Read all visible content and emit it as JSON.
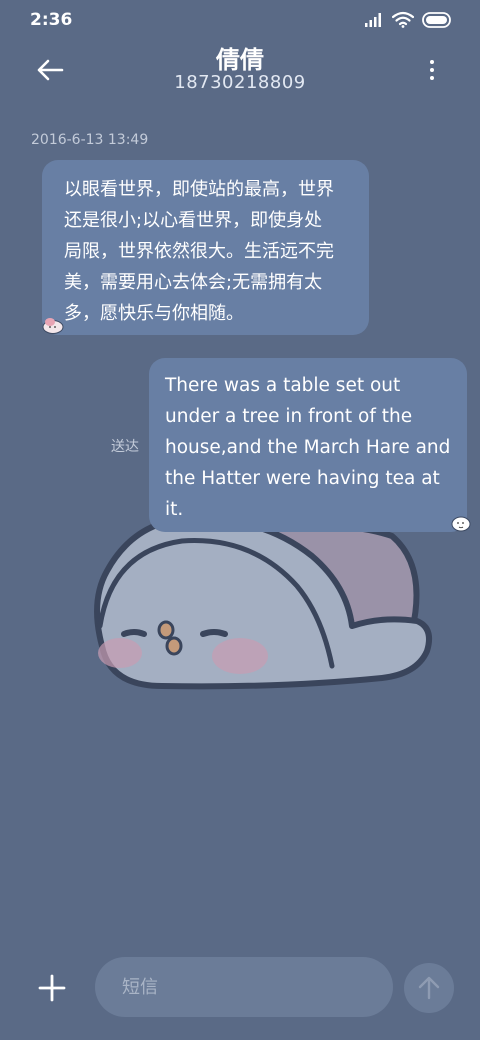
{
  "status_bar": {
    "time": "2:36",
    "icons": [
      "signal-icon",
      "wifi-icon",
      "battery-icon"
    ]
  },
  "header": {
    "back_icon": "back-arrow-icon",
    "contact_name": "倩倩",
    "contact_number": "18730218809",
    "more_icon": "more-vertical-icon"
  },
  "conversation": {
    "timestamp": "2016-6-13 13:49",
    "messages": [
      {
        "direction": "incoming",
        "lines": [
          "以眼看世界，即使站的最高，世界",
          "还是很小;以心看世界，即使身处",
          "局限，世界依然很大。生活远不完",
          "美，需要用心去体会;无需拥有太",
          "多，愿快乐与你相随。"
        ]
      },
      {
        "direction": "outgoing",
        "status": "送达",
        "lines": [
          "There was a table set out",
          "under a tree in front of the",
          "house,and the March Hare and",
          "the Hatter were having tea at",
          "it."
        ]
      }
    ]
  },
  "composer": {
    "placeholder": "短信",
    "value": "",
    "add_icon": "plus-icon",
    "send_icon": "send-arrow-icon"
  },
  "colors": {
    "background": "#5a6a86",
    "bubble": "#687fa4",
    "input": "#6b7c98"
  }
}
